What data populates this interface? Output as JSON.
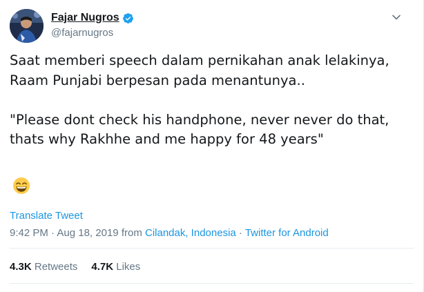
{
  "author": {
    "display_name": "Fajar Nugros",
    "handle": "@fajarnugros",
    "verified": true
  },
  "tweet": {
    "lines": [
      "Saat memberi speech dalam pernikahan anak lelakinya,",
      "Raam Punjabi berpesan pada menantunya..",
      "",
      "\"Please dont check his handphone, never never do that,",
      "thats why Rakhhe and me happy for 48 years\""
    ],
    "emoji": "grinning-face-with-smiling-eyes"
  },
  "translate_label": "Translate Tweet",
  "meta": {
    "time": "9:42 PM",
    "date": "Aug 18, 2019",
    "from_label": "from",
    "location": "Cilandak, Indonesia",
    "source": "Twitter for Android",
    "separator": "·"
  },
  "stats": {
    "retweets_count": "4.3K",
    "retweets_label": "Retweets",
    "likes_count": "4.7K",
    "likes_label": "Likes"
  },
  "colors": {
    "link": "#1b95e0",
    "secondary_text": "#657786",
    "verified": "#1da1f2"
  },
  "icons": {
    "verified": "verified-badge-icon",
    "caret": "chevron-down-icon"
  }
}
